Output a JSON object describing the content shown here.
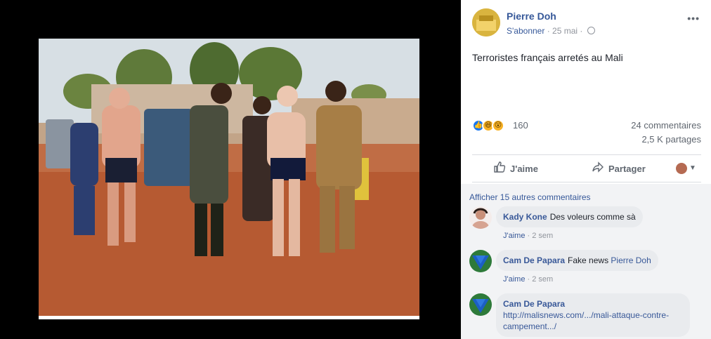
{
  "post": {
    "author": "Pierre Doh",
    "subscribe": "S'abonner",
    "separator": "·",
    "date": "25 mai",
    "text": "Terroristes français arretés au Mali",
    "more": "•••"
  },
  "reactions": {
    "count": "160",
    "comments": "24 commentaires",
    "shares": "2,5 K partages",
    "like_icon": "👍",
    "haha_icon": "😆",
    "wow_icon": "😮"
  },
  "actions": {
    "like": "J'aime",
    "share": "Partager",
    "like_icon": "thumb-up-icon",
    "share_icon": "share-arrow-icon"
  },
  "comments_section": {
    "more_comments": "Afficher 15 autres commentaires",
    "items": [
      {
        "name": "Kady Kone",
        "text": "Des voleurs comme sà",
        "mention": "",
        "link": "",
        "like": "J'aime",
        "time": "2 sem"
      },
      {
        "name": "Cam De Papara",
        "text": "Fake news",
        "mention": "Pierre Doh",
        "link": "",
        "like": "J'aime",
        "time": "2 sem"
      },
      {
        "name": "Cam De Papara",
        "text": "",
        "mention": "",
        "link": "http://malisnews.com/.../mali-attaque-contre-campement.../",
        "like": "",
        "time": ""
      }
    ]
  },
  "colors": {
    "link": "#365899",
    "meta": "#90949c",
    "bubble": "#e9ebee",
    "comments_bg": "#f2f3f5"
  }
}
